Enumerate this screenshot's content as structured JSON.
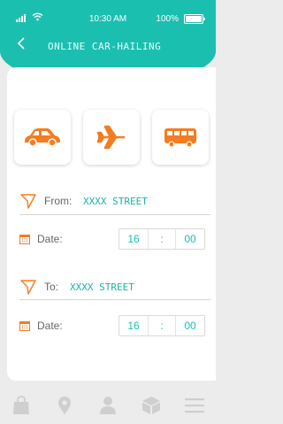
{
  "status_bar": {
    "time": "10:30 AM",
    "battery": "100%"
  },
  "header": {
    "title": "ONLINE CAR-HAILING",
    "back_icon": "chevron-left-icon"
  },
  "modes": [
    {
      "name": "car",
      "icon": "car-icon"
    },
    {
      "name": "plane",
      "icon": "airplane-icon"
    },
    {
      "name": "bus",
      "icon": "bus-icon"
    }
  ],
  "from": {
    "label": "From:",
    "address": "XXXX STREET",
    "icon": "navigation-icon"
  },
  "from_date": {
    "label": "Date:",
    "hour": "16",
    "separator": ":",
    "minute": "00",
    "icon": "calendar-icon"
  },
  "to": {
    "label": "To:",
    "address": "XXXX STREET",
    "icon": "navigation-icon"
  },
  "to_date": {
    "label": "Date:",
    "hour": "16",
    "separator": ":",
    "minute": "00",
    "icon": "calendar-icon"
  },
  "tab_bar": [
    {
      "name": "shopping-bag",
      "icon": "shopping-bag-icon"
    },
    {
      "name": "location",
      "icon": "location-pin-icon"
    },
    {
      "name": "profile",
      "icon": "user-icon"
    },
    {
      "name": "package",
      "icon": "box-icon"
    },
    {
      "name": "menu",
      "icon": "menu-icon"
    }
  ],
  "colors": {
    "accent": "#1bbfb0",
    "icon_orange": "#f57c1f",
    "background": "#ececec",
    "tab_icon": "#cfcfcf"
  }
}
